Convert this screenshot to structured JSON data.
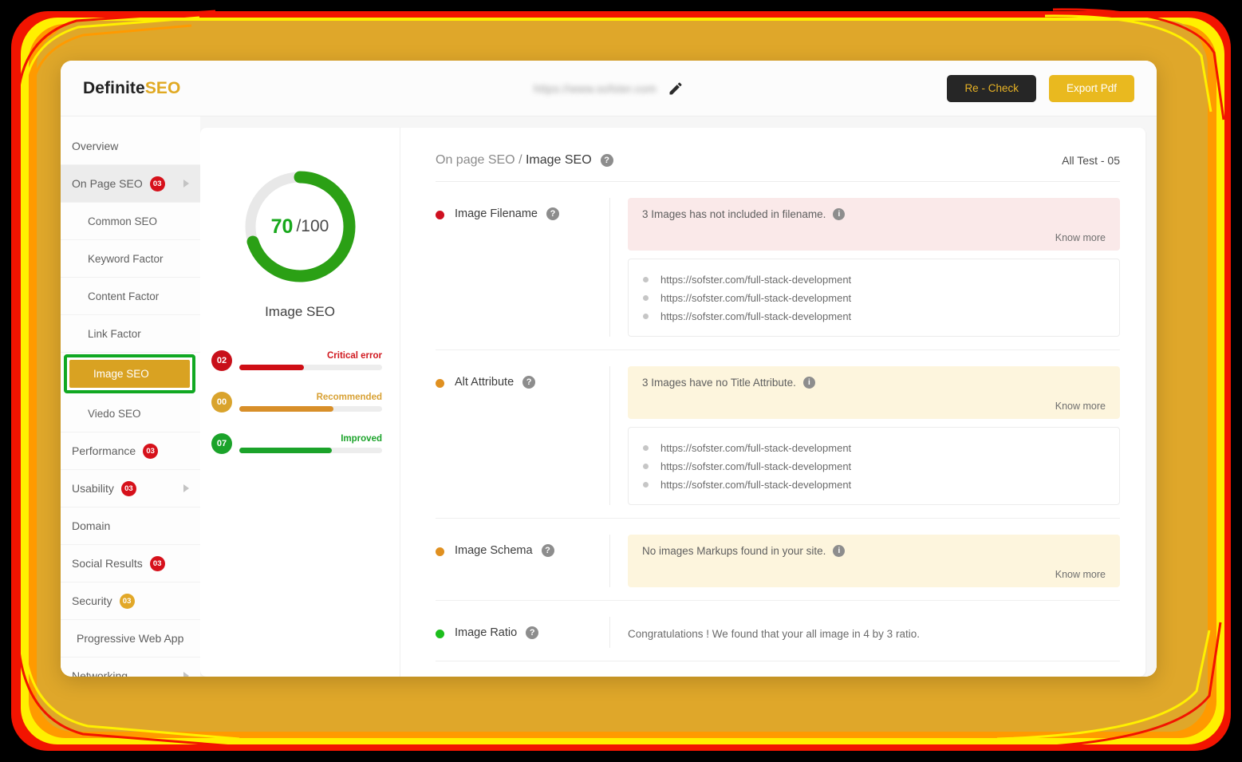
{
  "window": {
    "logo_main": "Definite",
    "logo_accent": "SEO",
    "url_value": "https://www.sofster.com",
    "edit_icon": "pencil-icon",
    "recheck_label": "Re - Check",
    "export_label": "Export Pdf"
  },
  "colors": {
    "brand_gold": "#e9b91f",
    "dark": "#262626",
    "critical_red": "#cf0e15",
    "recommended_amber": "#d88f29",
    "improved_green": "#1ba32a",
    "selection_green": "#10a822",
    "selected_item_gold": "#d9a222"
  },
  "sidebar": {
    "items": [
      {
        "label": "Overview",
        "badge": null,
        "caret": false,
        "level": "top"
      },
      {
        "label": "On Page SEO",
        "badge": "03",
        "badge_color": "red",
        "caret": true,
        "level": "top",
        "active": true
      },
      {
        "label": "Common SEO",
        "badge": null,
        "caret": false,
        "level": "sub"
      },
      {
        "label": "Keyword Factor",
        "badge": null,
        "caret": false,
        "level": "sub"
      },
      {
        "label": "Content Factor",
        "badge": null,
        "caret": false,
        "level": "sub"
      },
      {
        "label": "Link Factor",
        "badge": null,
        "caret": false,
        "level": "sub"
      },
      {
        "label": "Image SEO",
        "badge": null,
        "caret": false,
        "level": "sub",
        "selected": true
      },
      {
        "label": "Viedo SEO",
        "badge": null,
        "caret": false,
        "level": "sub"
      },
      {
        "label": "Performance",
        "badge": "03",
        "badge_color": "red",
        "caret": false,
        "level": "top"
      },
      {
        "label": "Usability",
        "badge": "03",
        "badge_color": "red",
        "caret": true,
        "level": "top"
      },
      {
        "label": "Domain",
        "badge": null,
        "caret": false,
        "level": "top"
      },
      {
        "label": "Social Results",
        "badge": "03",
        "badge_color": "red",
        "caret": false,
        "level": "top"
      },
      {
        "label": "Security",
        "badge": "03",
        "badge_color": "gold",
        "caret": false,
        "level": "top"
      },
      {
        "label": "Progressive Web App",
        "badge": null,
        "caret": false,
        "level": "indent"
      },
      {
        "label": "Networking",
        "badge": null,
        "caret": true,
        "level": "top"
      }
    ]
  },
  "score_panel": {
    "score": "70",
    "total": "/100",
    "label": "Image SEO",
    "percent": 70,
    "stats": [
      {
        "count": "02",
        "title": "Critical error",
        "color": "red",
        "fill_percent": 45
      },
      {
        "count": "00",
        "title": "Recommended",
        "color": "amber",
        "fill_percent": 66
      },
      {
        "count": "07",
        "title": "Improved",
        "color": "green",
        "fill_percent": 65
      }
    ]
  },
  "tests_panel": {
    "breadcrumb_parent": "On page SEO",
    "breadcrumb_sep": " / ",
    "breadcrumb_current": "Image SEO",
    "help_glyph": "?",
    "info_glyph": "i",
    "all_test": "All Test - 05",
    "know_more_label": "Know more",
    "rows": [
      {
        "name": "Image Filename",
        "dot": "red",
        "alert_style": "pink",
        "alert_text": "3 Images has not included in filename.",
        "urls": [
          "https://sofster.com/full-stack-development",
          "https://sofster.com/full-stack-development",
          "https://sofster.com/full-stack-development"
        ]
      },
      {
        "name": "Alt Attribute",
        "dot": "orange",
        "alert_style": "yellow",
        "alert_text": "3 Images have no Title Attribute.",
        "urls": [
          "https://sofster.com/full-stack-development",
          "https://sofster.com/full-stack-development",
          "https://sofster.com/full-stack-development"
        ]
      },
      {
        "name": "Image Schema",
        "dot": "orange",
        "alert_style": "yellow",
        "alert_text": "No images Markups found in your site.",
        "urls": []
      },
      {
        "name": "Image Ratio",
        "dot": "green",
        "alert_style": "none",
        "alert_text": "Congratulations ! We found that your all image in 4 by 3 ratio.",
        "urls": []
      }
    ]
  }
}
